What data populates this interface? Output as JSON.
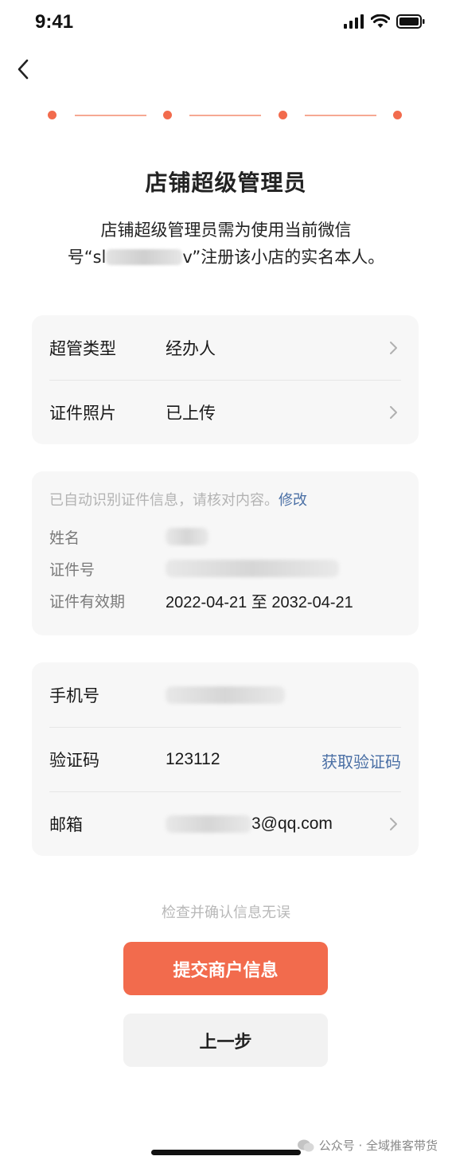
{
  "status_bar": {
    "time": "9:41"
  },
  "header": {
    "title": "店铺超级管理员",
    "subtitle_line1": "店铺超级管理员需为使用当前微信",
    "subtitle_prefix": "号“sl",
    "subtitle_suffix": "v”注册该小店的实名本人。"
  },
  "steps": {
    "count": 4,
    "color": "#f26b4d"
  },
  "admin_card": {
    "type_label": "超管类型",
    "type_value": "经办人",
    "photo_label": "证件照片",
    "photo_value": "已上传"
  },
  "info_card": {
    "hint": "已自动识别证件信息，请核对内容。",
    "edit_link": "修改",
    "name_label": "姓名",
    "id_label": "证件号",
    "validity_label": "证件有效期",
    "validity_value": "2022-04-21 至 2032-04-21"
  },
  "contact_card": {
    "phone_label": "手机号",
    "code_label": "验证码",
    "code_value": "123112",
    "get_code": "获取验证码",
    "email_label": "邮箱",
    "email_suffix": "3@qq.com"
  },
  "footer": {
    "confirm_hint": "检查并确认信息无误",
    "submit_label": "提交商户信息",
    "prev_label": "上一步"
  },
  "watermark": {
    "text": "公众号 · 全域推客带货"
  },
  "colors": {
    "accent": "#f26b4d",
    "link": "#4a6fa5"
  }
}
